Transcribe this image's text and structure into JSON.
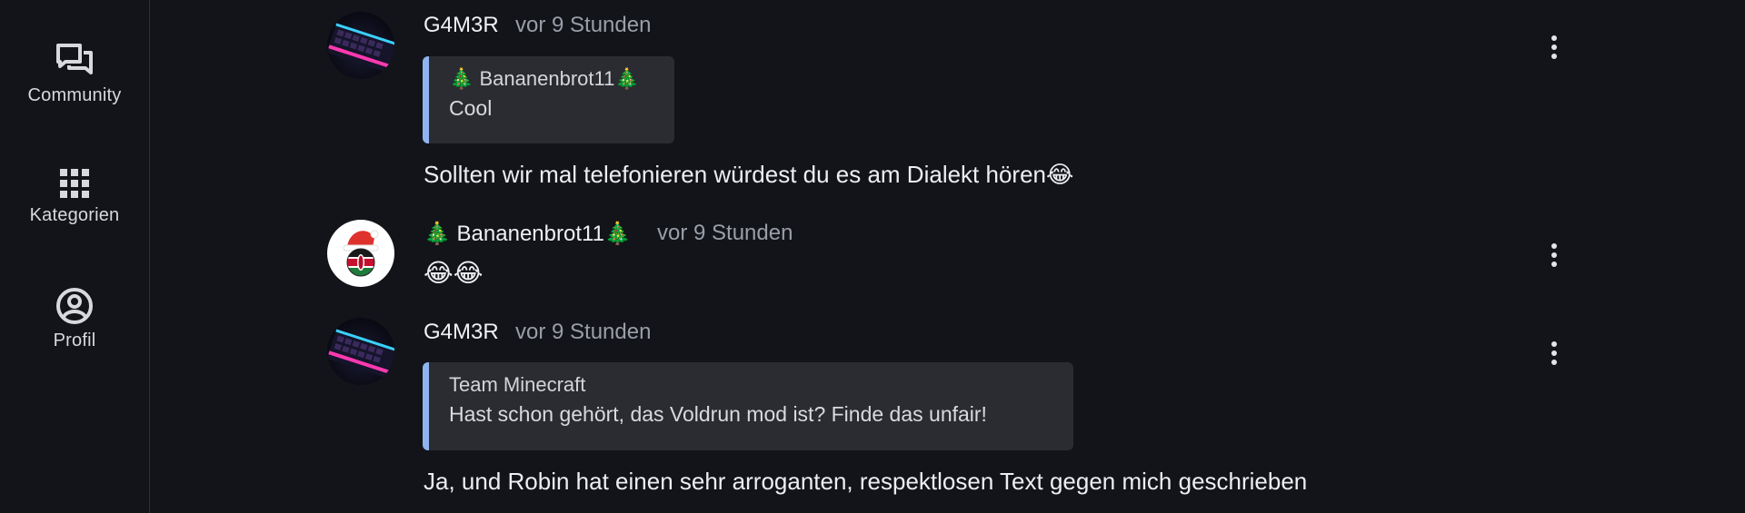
{
  "sidebar": {
    "items": [
      {
        "label": "Community",
        "icon": "forum-icon"
      },
      {
        "label": "Kategorien",
        "icon": "grid-icon"
      },
      {
        "label": "Profil",
        "icon": "user-circle-icon"
      }
    ]
  },
  "messages": [
    {
      "author": "G4M3R",
      "time": "vor 9 Stunden",
      "quote": {
        "author": "🎄 Bananenbrot11🎄",
        "text": "Cool"
      },
      "text": "Sollten wir mal telefonieren würdest du es am Dialekt hören😂"
    },
    {
      "author": "🎄 Bananenbrot11🎄",
      "time": "vor 9 Stunden",
      "text": "😂😂"
    },
    {
      "author": "G4M3R",
      "time": "vor 9 Stunden",
      "quote": {
        "author": "Team Minecraft",
        "text": "Hast schon gehört, das Voldrun mod ist? Finde das unfair!"
      },
      "text": "Ja, und Robin hat einen sehr arroganten, respektlosen Text gegen mich geschrieben"
    }
  ],
  "colors": {
    "background": "#121419",
    "quote_background": "#2a2c31",
    "quote_accent": "#8fb4f0",
    "muted_text": "#9a9ea8"
  }
}
